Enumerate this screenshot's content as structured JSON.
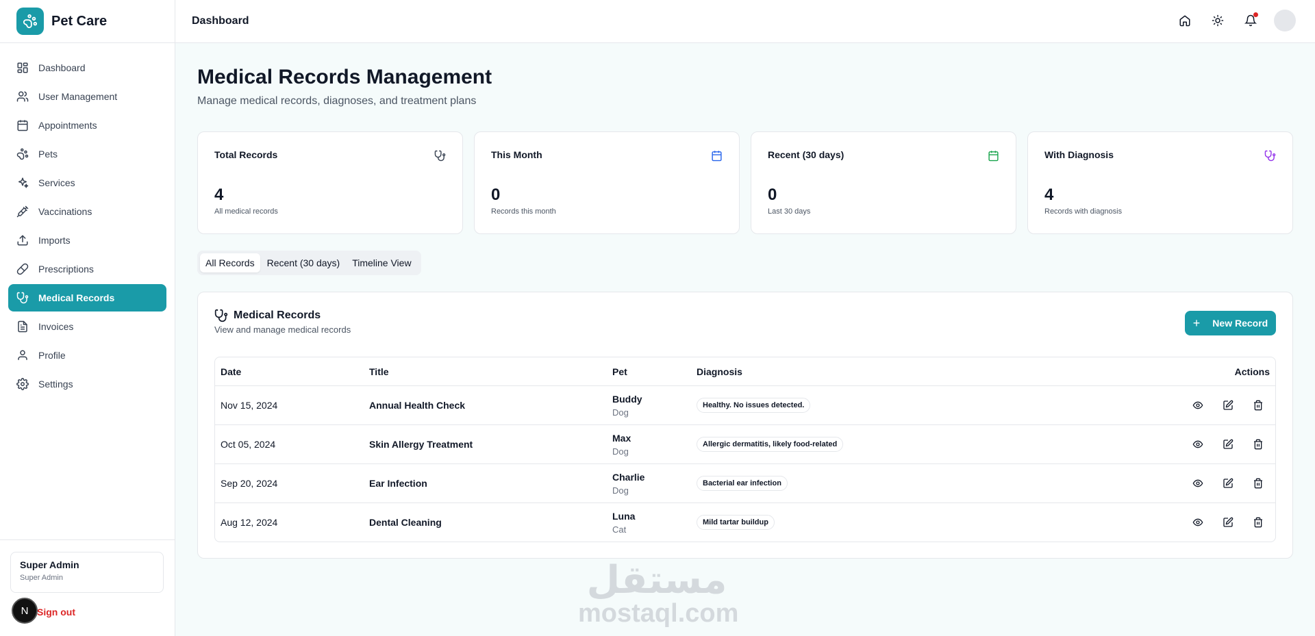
{
  "app": {
    "name": "Pet Care",
    "accent": "#1a9ba8"
  },
  "topbar": {
    "title": "Dashboard",
    "icons": [
      "home-icon",
      "sun-icon",
      "bell-icon"
    ]
  },
  "sidebar": {
    "items": [
      {
        "label": "Dashboard",
        "icon": "grid-icon"
      },
      {
        "label": "User Management",
        "icon": "users-icon"
      },
      {
        "label": "Appointments",
        "icon": "calendar-icon"
      },
      {
        "label": "Pets",
        "icon": "paw-icon"
      },
      {
        "label": "Services",
        "icon": "sparkles-icon"
      },
      {
        "label": "Vaccinations",
        "icon": "syringe-icon"
      },
      {
        "label": "Imports",
        "icon": "upload-icon"
      },
      {
        "label": "Prescriptions",
        "icon": "pill-icon"
      },
      {
        "label": "Medical Records",
        "icon": "stethoscope-icon",
        "active": true
      },
      {
        "label": "Invoices",
        "icon": "file-icon"
      },
      {
        "label": "Profile",
        "icon": "user-icon"
      },
      {
        "label": "Settings",
        "icon": "gear-icon"
      }
    ],
    "user": {
      "name": "Super Admin",
      "role": "Super Admin"
    },
    "signout_label": "Sign out",
    "badge_letter": "N"
  },
  "page": {
    "title": "Medical Records Management",
    "subtitle": "Manage medical records, diagnoses, and treatment plans"
  },
  "stats": [
    {
      "label": "Total Records",
      "value": "4",
      "desc": "All medical records",
      "icon": "stethoscope-icon",
      "color": "#374151"
    },
    {
      "label": "This Month",
      "value": "0",
      "desc": "Records this month",
      "icon": "calendar-icon",
      "color": "#2563eb"
    },
    {
      "label": "Recent (30 days)",
      "value": "0",
      "desc": "Last 30 days",
      "icon": "calendar-icon",
      "color": "#16a34a"
    },
    {
      "label": "With Diagnosis",
      "value": "4",
      "desc": "Records with diagnosis",
      "icon": "stethoscope-icon",
      "color": "#9333ea"
    }
  ],
  "tabs": [
    {
      "label": "All Records",
      "active": true
    },
    {
      "label": "Recent (30 days)"
    },
    {
      "label": "Timeline View"
    }
  ],
  "records": {
    "title": "Medical Records",
    "subtitle": "View and manage medical records",
    "new_button": "New Record",
    "columns": {
      "date": "Date",
      "title": "Title",
      "pet": "Pet",
      "diagnosis": "Diagnosis",
      "actions": "Actions"
    },
    "rows": [
      {
        "date": "Nov 15, 2024",
        "title": "Annual Health Check",
        "pet": "Buddy",
        "species": "Dog",
        "diagnosis": "Healthy. No issues detected."
      },
      {
        "date": "Oct 05, 2024",
        "title": "Skin Allergy Treatment",
        "pet": "Max",
        "species": "Dog",
        "diagnosis": "Allergic dermatitis, likely food-related"
      },
      {
        "date": "Sep 20, 2024",
        "title": "Ear Infection",
        "pet": "Charlie",
        "species": "Dog",
        "diagnosis": "Bacterial ear infection"
      },
      {
        "date": "Aug 12, 2024",
        "title": "Dental Cleaning",
        "pet": "Luna",
        "species": "Cat",
        "diagnosis": "Mild tartar buildup"
      }
    ]
  },
  "watermark": {
    "arabic": "مستقل",
    "latin": "mostaql.com"
  }
}
